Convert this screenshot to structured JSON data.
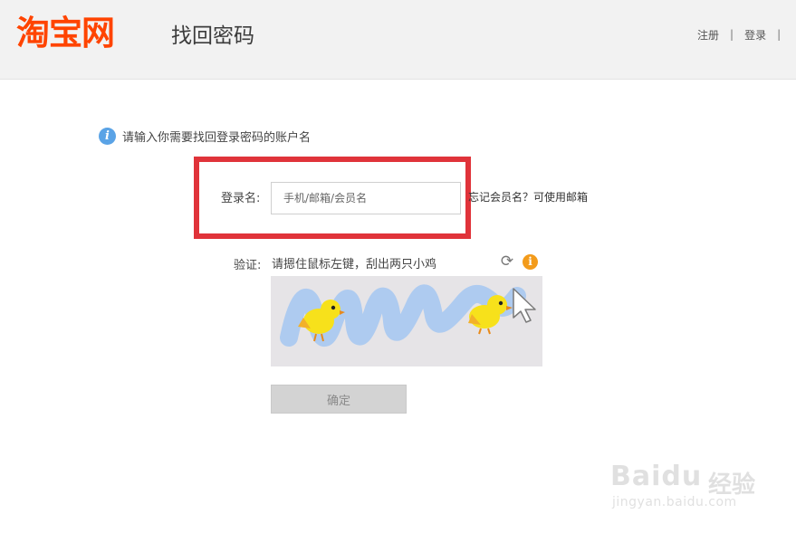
{
  "header": {
    "logo": "淘宝网",
    "title": "找回密码",
    "links": {
      "register": "注册",
      "login": "登录"
    }
  },
  "form": {
    "tip": "请输入你需要找回登录密码的账户名",
    "login_label": "登录名:",
    "login_placeholder": "手机/邮箱/会员名",
    "login_value": "",
    "forgot_link": "忘记会员名？可使用邮箱",
    "verify_label": "验证:",
    "verify_hint": "请摁住鼠标左键，刮出两只小鸡",
    "confirm_label": "确定"
  },
  "icons": {
    "tip": "info-icon",
    "refresh": "refresh-icon",
    "help": "warning-info-icon",
    "cursor": "mouse-cursor-icon"
  },
  "colors": {
    "brand": "#ff4400",
    "highlight": "#e0333a",
    "info": "#5aa3e6",
    "warn": "#f39b1b",
    "scratch": "#aecbf0",
    "chick": "#f7e11b"
  },
  "watermark": {
    "brand": "Baidu",
    "cn": "经验",
    "url": "jingyan.baidu.com"
  }
}
